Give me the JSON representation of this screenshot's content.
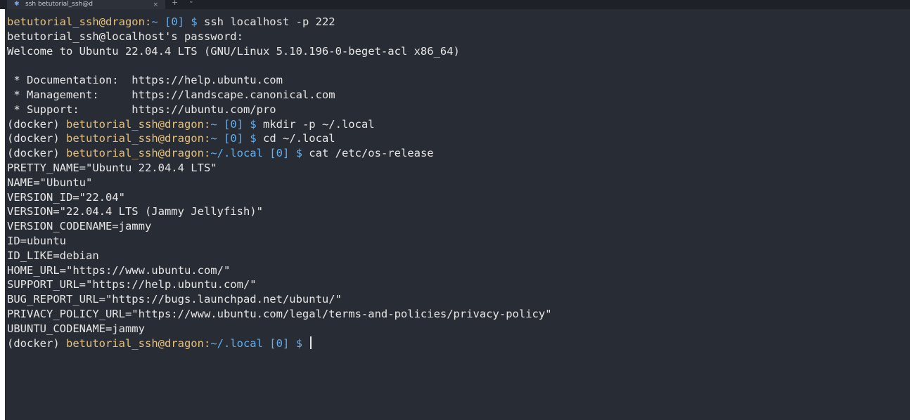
{
  "tab": {
    "icon": "terminal-icon",
    "title": "ssh betutorial_ssh@d",
    "close_glyph": "×",
    "new_glyph": "+",
    "dropdown_glyph": "⌄"
  },
  "terminal": {
    "lines": [
      {
        "user": "betutorial_ssh@dragon:",
        "cwd": "~",
        "status": " [0] $",
        "cmd": " ssh localhost -p 222"
      },
      {
        "text": "betutorial_ssh@localhost's password:"
      },
      {
        "text": "Welcome to Ubuntu 22.04.4 LTS (GNU/Linux 5.10.196-0-beget-acl x86_64)"
      },
      {
        "text": ""
      },
      {
        "text": " * Documentation:  https://help.ubuntu.com"
      },
      {
        "text": " * Management:     https://landscape.canonical.com"
      },
      {
        "text": " * Support:        https://ubuntu.com/pro"
      },
      {
        "env": "(docker) ",
        "user": "betutorial_ssh@dragon:",
        "cwd": "~",
        "status": " [0] $",
        "cmd": " mkdir -p ~/.local"
      },
      {
        "env": "(docker) ",
        "user": "betutorial_ssh@dragon:",
        "cwd": "~",
        "status": " [0] $",
        "cmd": " cd ~/.local"
      },
      {
        "env": "(docker) ",
        "user": "betutorial_ssh@dragon:",
        "cwd": "~/.local",
        "status": " [0] $",
        "cmd": " cat /etc/os-release"
      },
      {
        "text": "PRETTY_NAME=\"Ubuntu 22.04.4 LTS\""
      },
      {
        "text": "NAME=\"Ubuntu\""
      },
      {
        "text": "VERSION_ID=\"22.04\""
      },
      {
        "text": "VERSION=\"22.04.4 LTS (Jammy Jellyfish)\""
      },
      {
        "text": "VERSION_CODENAME=jammy"
      },
      {
        "text": "ID=ubuntu"
      },
      {
        "text": "ID_LIKE=debian"
      },
      {
        "text": "HOME_URL=\"https://www.ubuntu.com/\""
      },
      {
        "text": "SUPPORT_URL=\"https://help.ubuntu.com/\""
      },
      {
        "text": "BUG_REPORT_URL=\"https://bugs.launchpad.net/ubuntu/\""
      },
      {
        "text": "PRIVACY_POLICY_URL=\"https://www.ubuntu.com/legal/terms-and-policies/privacy-policy\""
      },
      {
        "text": "UBUNTU_CODENAME=jammy"
      },
      {
        "env": "(docker) ",
        "user": "betutorial_ssh@dragon:",
        "cwd": "~/.local",
        "status": " [0] $",
        "cmd": " ",
        "cursor": true
      }
    ]
  },
  "colors": {
    "background": "#282c34",
    "user": "#e5c07b",
    "path": "#61afef",
    "text": "#e6e6e6"
  }
}
